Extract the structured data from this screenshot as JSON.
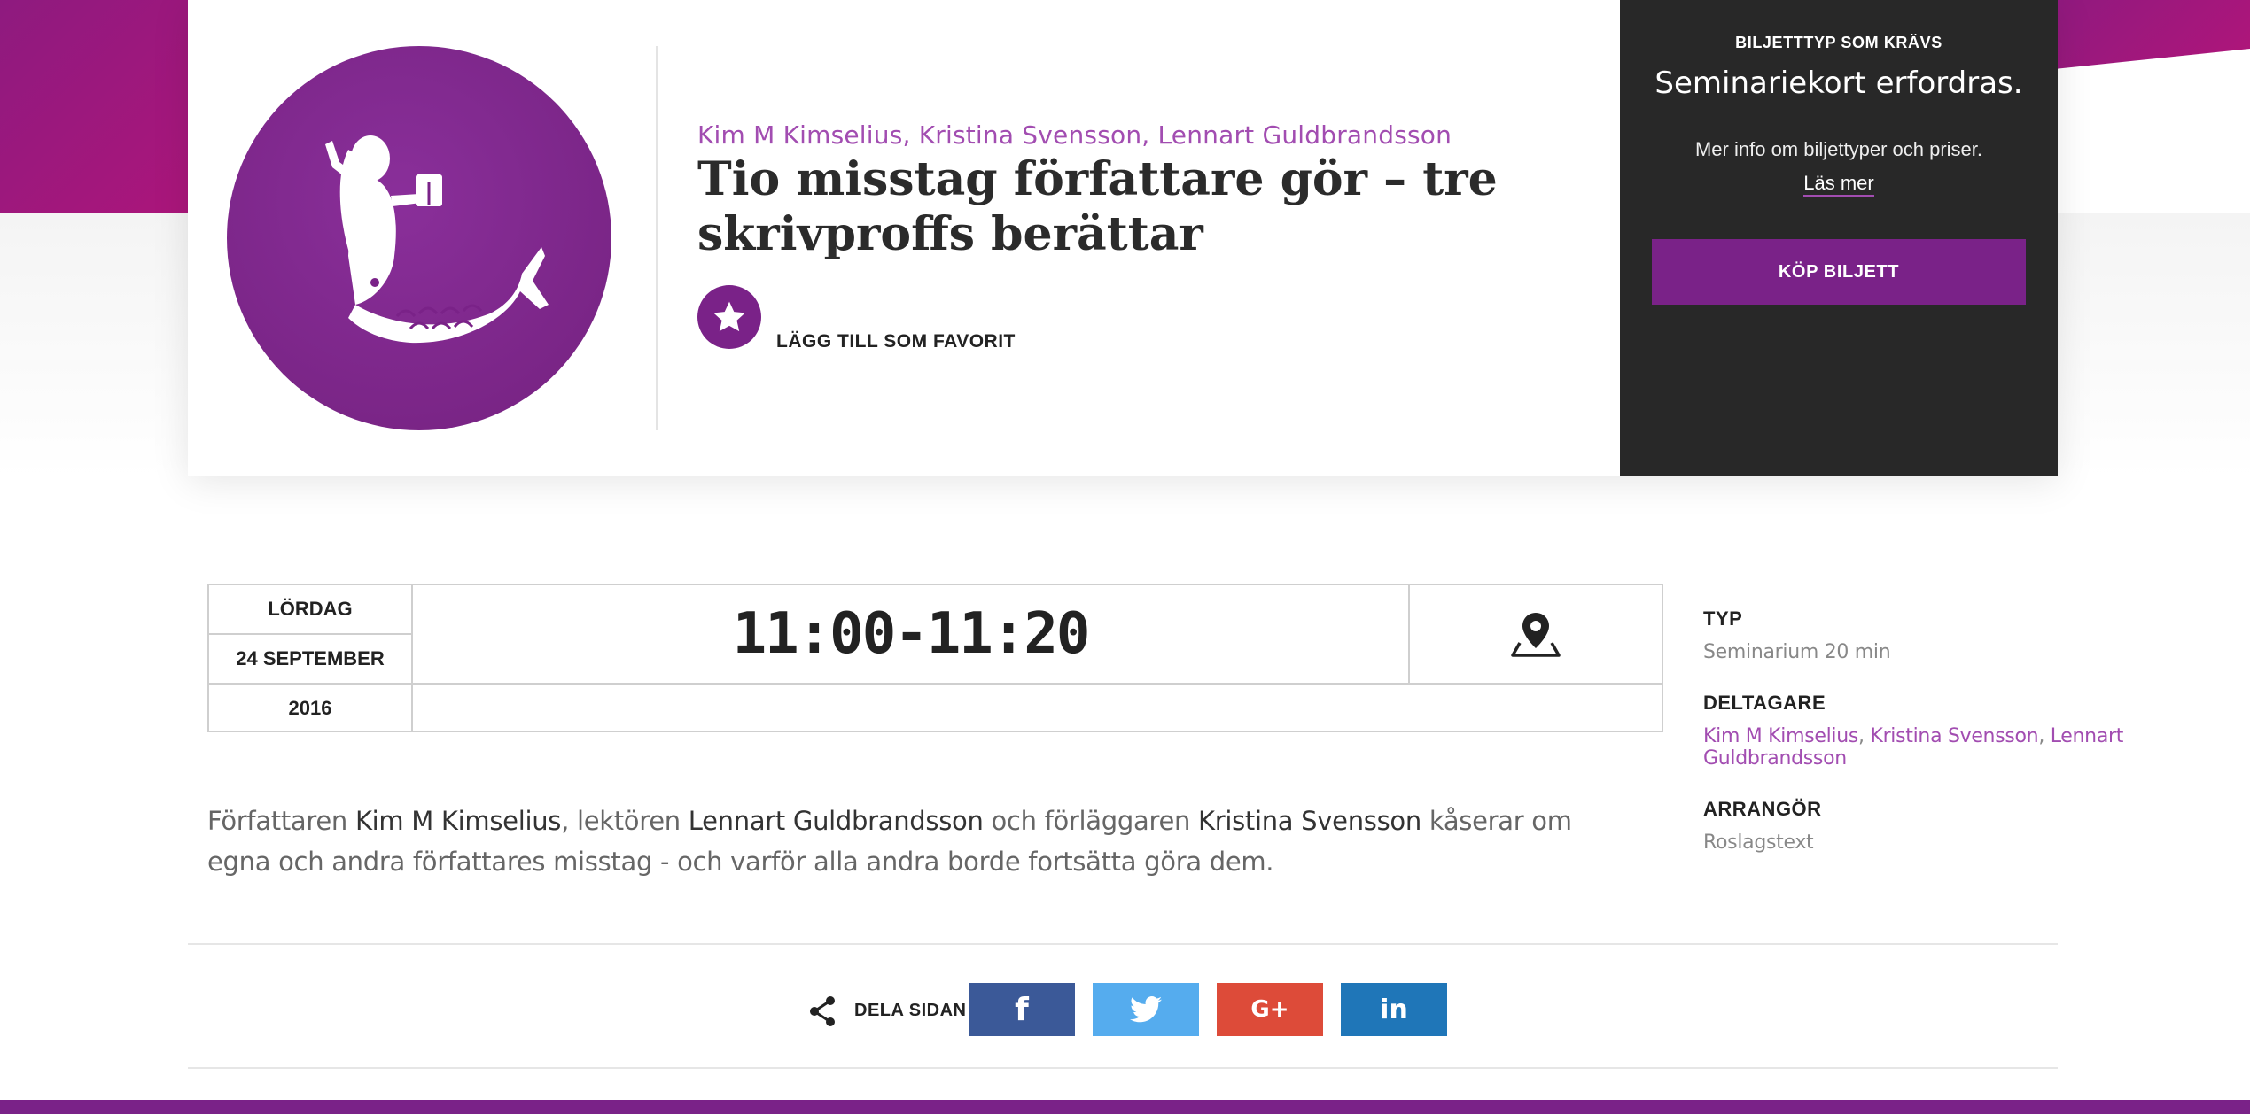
{
  "event": {
    "authors": "Kim M Kimselius, Kristina Svensson, Lennart Guldbrandsson",
    "title": "Tio misstag författare gör – tre skrivproffs berättar",
    "favorite_label": "LÄGG TILL SOM FAVORIT"
  },
  "ticket": {
    "type_label": "BILJETTTYP SOM KRÄVS",
    "requirement": "Seminariekort erfordras.",
    "info": "Mer info om biljettyper och priser.",
    "more_link": "Läs mer",
    "buy_label": "KÖP BILJETT"
  },
  "schedule": {
    "weekday": "LÖRDAG",
    "date": "24 SEPTEMBER",
    "year": "2016",
    "time": "11:00-11:20",
    "map_icon": "map-pin-icon"
  },
  "description": {
    "p1": "Författaren ",
    "n1": "Kim M Kimselius",
    "p2": ", lektören ",
    "n2": "Lennart Guldbrandsson",
    "p3": " och förläggaren ",
    "n3": "Kristina Svensson",
    "p4": " kåserar om egna och andra författares misstag - och varför alla andra borde fortsätta göra dem."
  },
  "details": {
    "type_heading": "TYP",
    "type_value": "Seminarium 20 min",
    "participants_heading": "DELTAGARE",
    "participants": [
      "Kim M Kimselius",
      "Kristina Svensson",
      "Lennart Guldbrandsson"
    ],
    "separator": ", ",
    "organizer_heading": "ARRANGÖR",
    "organizer_value": "Roslagstext"
  },
  "share": {
    "label": "DELA SIDAN",
    "icons": [
      "facebook-icon",
      "twitter-icon",
      "google-plus-icon",
      "linkedin-icon"
    ],
    "gplus_text": "G+",
    "linkedin_text": "in",
    "facebook_text": "f"
  },
  "colors": {
    "brand_purple": "#7a2288",
    "accent_link": "#a24db1",
    "dark_panel": "#282828",
    "facebook": "#3b5998",
    "twitter": "#55acee",
    "google_plus": "#dd4b39",
    "linkedin": "#1f76b8"
  }
}
